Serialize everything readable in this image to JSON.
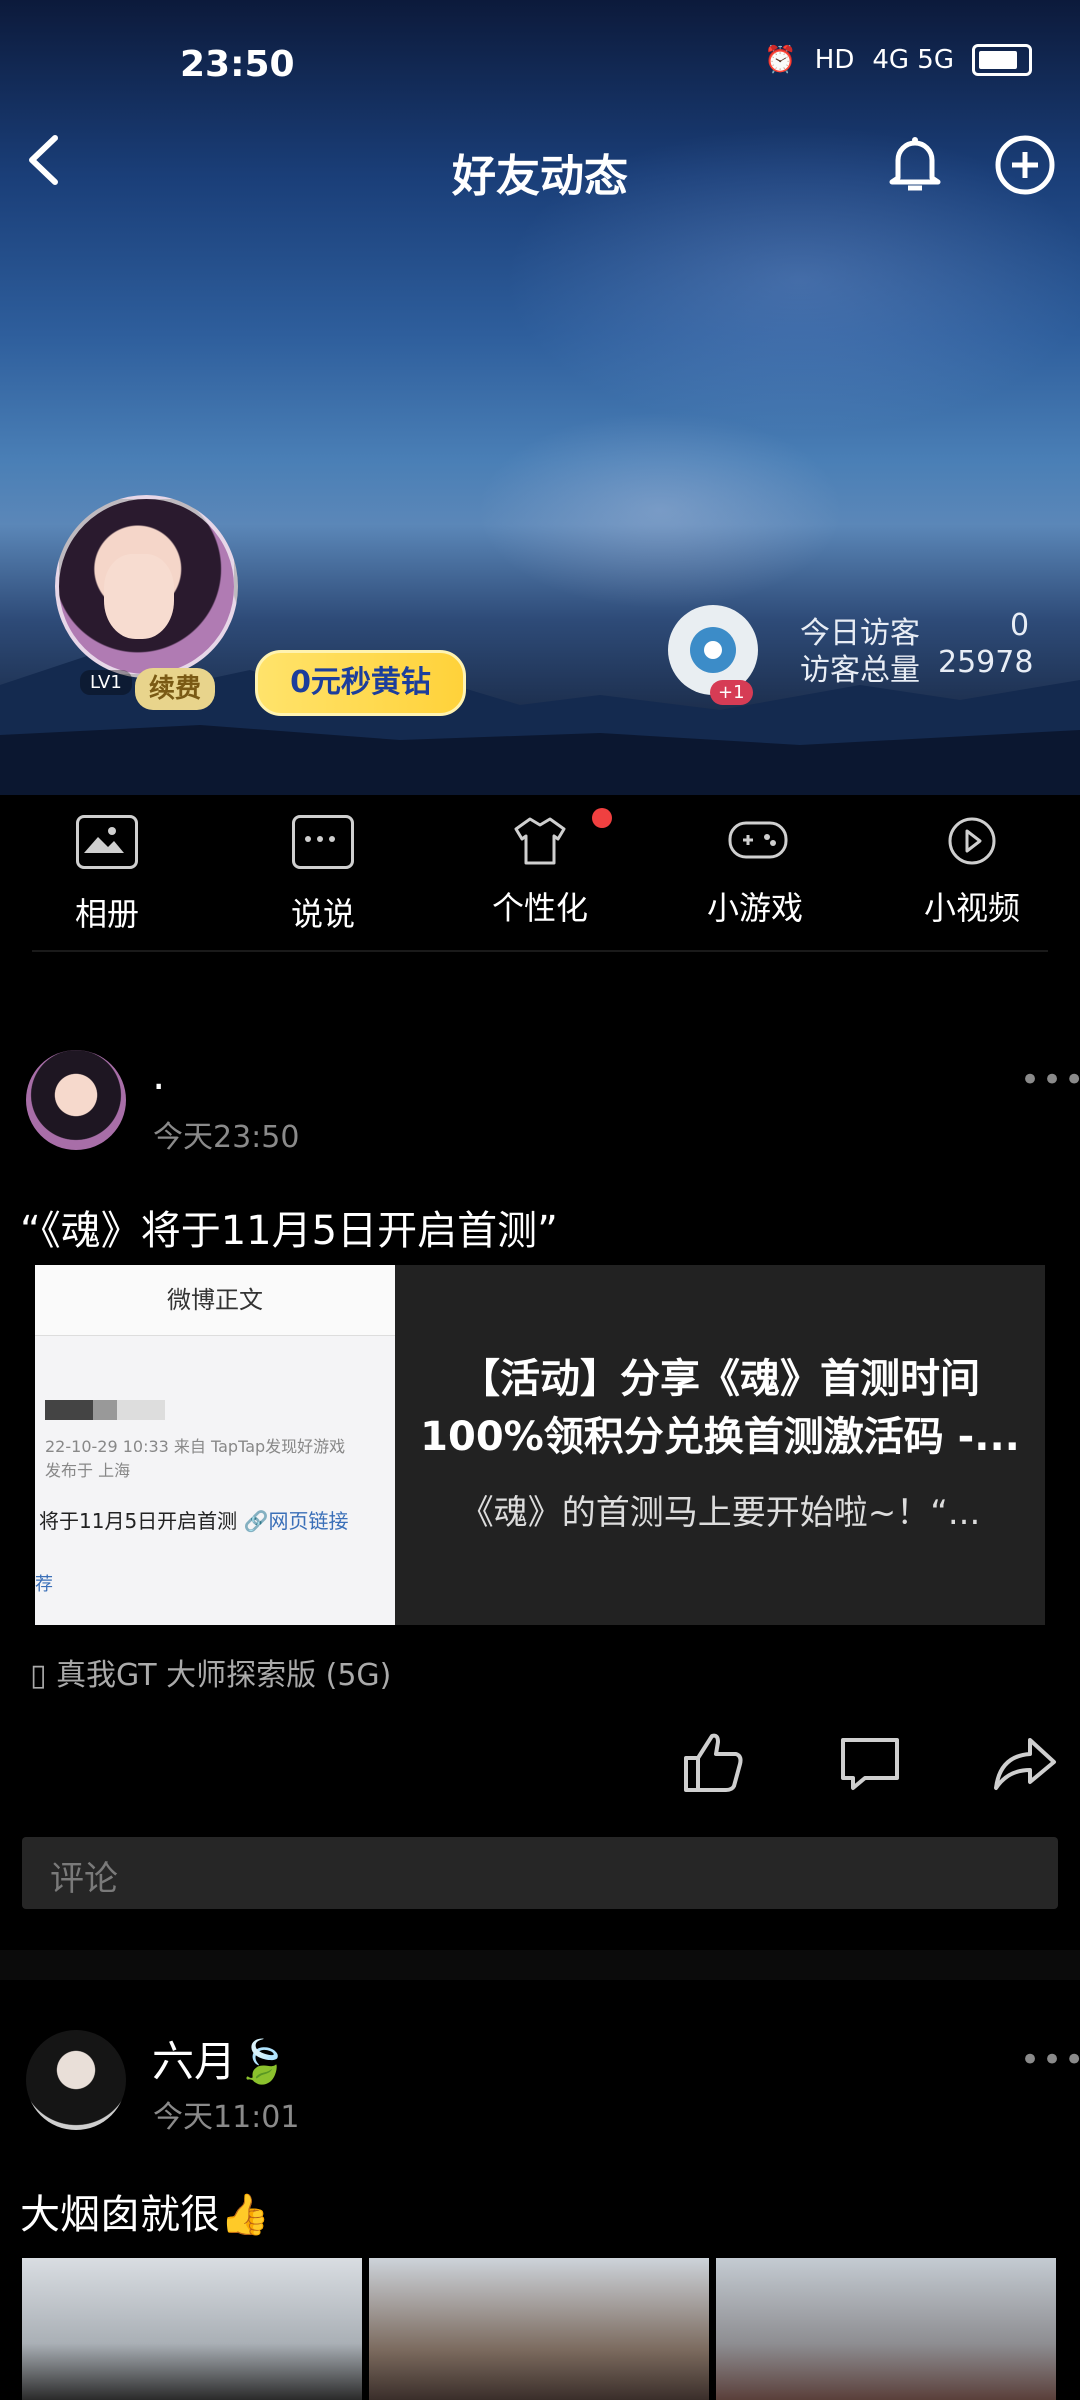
{
  "status_bar": {
    "time": "23:50",
    "signal": "4G 5G",
    "hd": "HD"
  },
  "nav": {
    "title": "好友动态"
  },
  "profile": {
    "level": "LV1",
    "renew_label": "续费",
    "promo_label": "0元秒黄钻",
    "badge_plus": "+1",
    "today_visits_label": "今日访客",
    "today_visits_value": "0",
    "total_visits_label": "访客总量",
    "total_visits_value": "25978"
  },
  "features": [
    {
      "label": "相册",
      "icon": "photo-icon"
    },
    {
      "label": "说说",
      "icon": "chat-icon"
    },
    {
      "label": "个性化",
      "icon": "shirt-icon"
    },
    {
      "label": "小游戏",
      "icon": "gamepad-icon"
    },
    {
      "label": "小视频",
      "icon": "play-icon"
    }
  ],
  "posts": [
    {
      "name": ".",
      "time": "今天23:50",
      "text": "“《魂》将于11月5日开启首测”",
      "card": {
        "thumb_title": "微博正文",
        "thumb_meta1": "22-10-29 10:33  来自 TapTap发现好游戏",
        "thumb_meta2": "发布于 上海",
        "thumb_line": "将于11月5日开启首测",
        "thumb_link": "🔗网页链接",
        "thumb_more": "荐",
        "title": "【活动】分享《魂》首测时间100%领积分兑换首测激活码 -...",
        "desc": "《魂》的首测马上要开始啦~！“..."
      },
      "device": "真我GT 大师探索版 (5G)",
      "comment_placeholder": "评论"
    },
    {
      "name": "六月🍃",
      "time": "今天11:01",
      "text": "大烟囱就很👍"
    }
  ],
  "colors": {
    "accent_red": "#f04040",
    "gold": "#ffd23a"
  }
}
